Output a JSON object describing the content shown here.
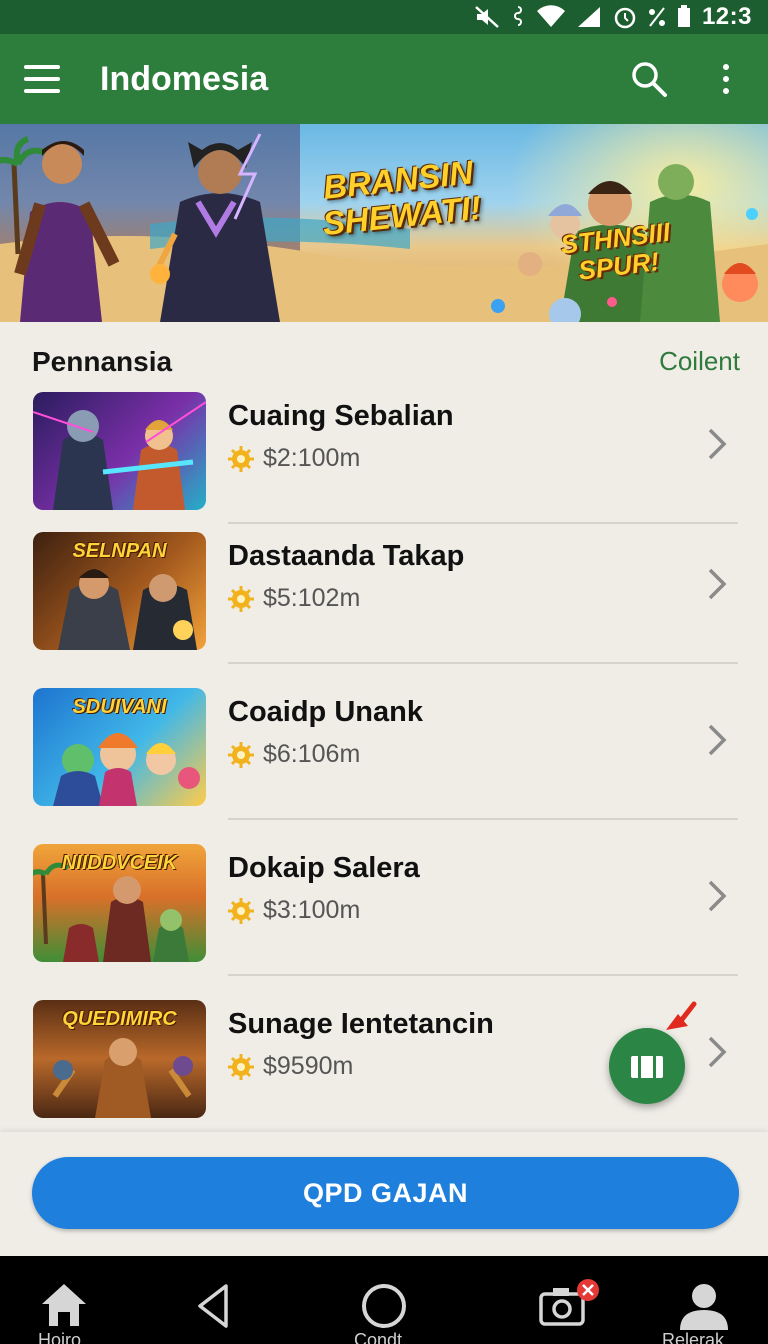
{
  "status_bar": {
    "time": "12:3"
  },
  "app_bar": {
    "title": "Indomesia"
  },
  "hero": {
    "title": "BRANSIN SHEWATI!",
    "subtitle": "STHNSIII SPUR!"
  },
  "section": {
    "title": "Pennansia",
    "action": "Coilent"
  },
  "games": [
    {
      "name": "Cuaing Sebalian",
      "price": "$2:100m",
      "thumb_label": ""
    },
    {
      "name": "Dastaanda Takap",
      "price": "$5:102m",
      "thumb_label": "SELNPAN"
    },
    {
      "name": "Coaidp Unank",
      "price": "$6:106m",
      "thumb_label": "SDUIVANI"
    },
    {
      "name": "Dokaip Salera",
      "price": "$3:100m",
      "thumb_label": "NIIDDVCEIK"
    },
    {
      "name": "Sunage Ientetancin",
      "price": "$9590m",
      "thumb_label": "QUEDIMIRC"
    }
  ],
  "primary_button": {
    "label": "QPD GAJAN"
  },
  "nav": {
    "items": [
      {
        "label": "Hoiro"
      },
      {
        "label": ""
      },
      {
        "label": "Condt"
      },
      {
        "label": ""
      },
      {
        "label": "Relerak"
      }
    ]
  },
  "colors": {
    "app_bar": "#2d7d3d",
    "status_bar": "#1c5e2f",
    "accent_green": "#2f7a3c",
    "button_blue": "#1f7fdc",
    "fab": "#2b8545",
    "badge_red": "#e53935"
  }
}
